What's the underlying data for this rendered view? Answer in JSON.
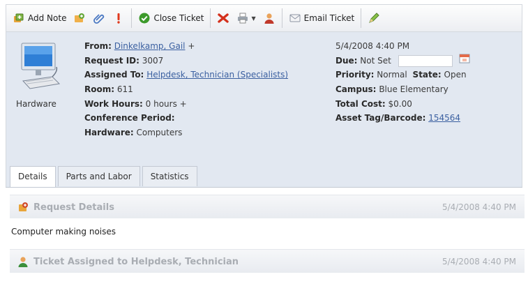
{
  "toolbar": {
    "add_note": "Add Note",
    "close_ticket": "Close Ticket",
    "email_ticket": "Email Ticket"
  },
  "ticket": {
    "category": "Hardware",
    "from_label": "From:",
    "from_value": "Dinkelkamp, Gail",
    "from_add": "+",
    "request_id_label": "Request ID:",
    "request_id_value": "3007",
    "assigned_label": "Assigned To:",
    "assigned_value": "Helpdesk, Technician (Specialists)",
    "room_label": "Room:",
    "room_value": "611",
    "work_hours_label": "Work Hours:",
    "work_hours_value": "0 hours +",
    "conference_label": "Conference Period:",
    "hardware_label": "Hardware:",
    "hardware_value": "Computers",
    "created": "5/4/2008 4:40 PM",
    "due_label": "Due:",
    "due_value": "Not Set",
    "priority_label": "Priority:",
    "priority_value": "Normal",
    "state_label": "State:",
    "state_value": "Open",
    "campus_label": "Campus:",
    "campus_value": "Blue Elementary",
    "total_cost_label": "Total Cost:",
    "total_cost_value": "$0.00",
    "asset_label": "Asset Tag/Barcode:",
    "asset_value": "154564"
  },
  "tabs": [
    {
      "label": "Details",
      "active": true
    },
    {
      "label": "Parts and Labor",
      "active": false
    },
    {
      "label": "Statistics",
      "active": false
    }
  ],
  "timeline": [
    {
      "title": "Request Details",
      "time": "5/4/2008 4:40 PM",
      "body": "Computer making noises"
    },
    {
      "title": "Ticket Assigned to Helpdesk, Technician",
      "time": "5/4/2008 4:40 PM"
    }
  ]
}
